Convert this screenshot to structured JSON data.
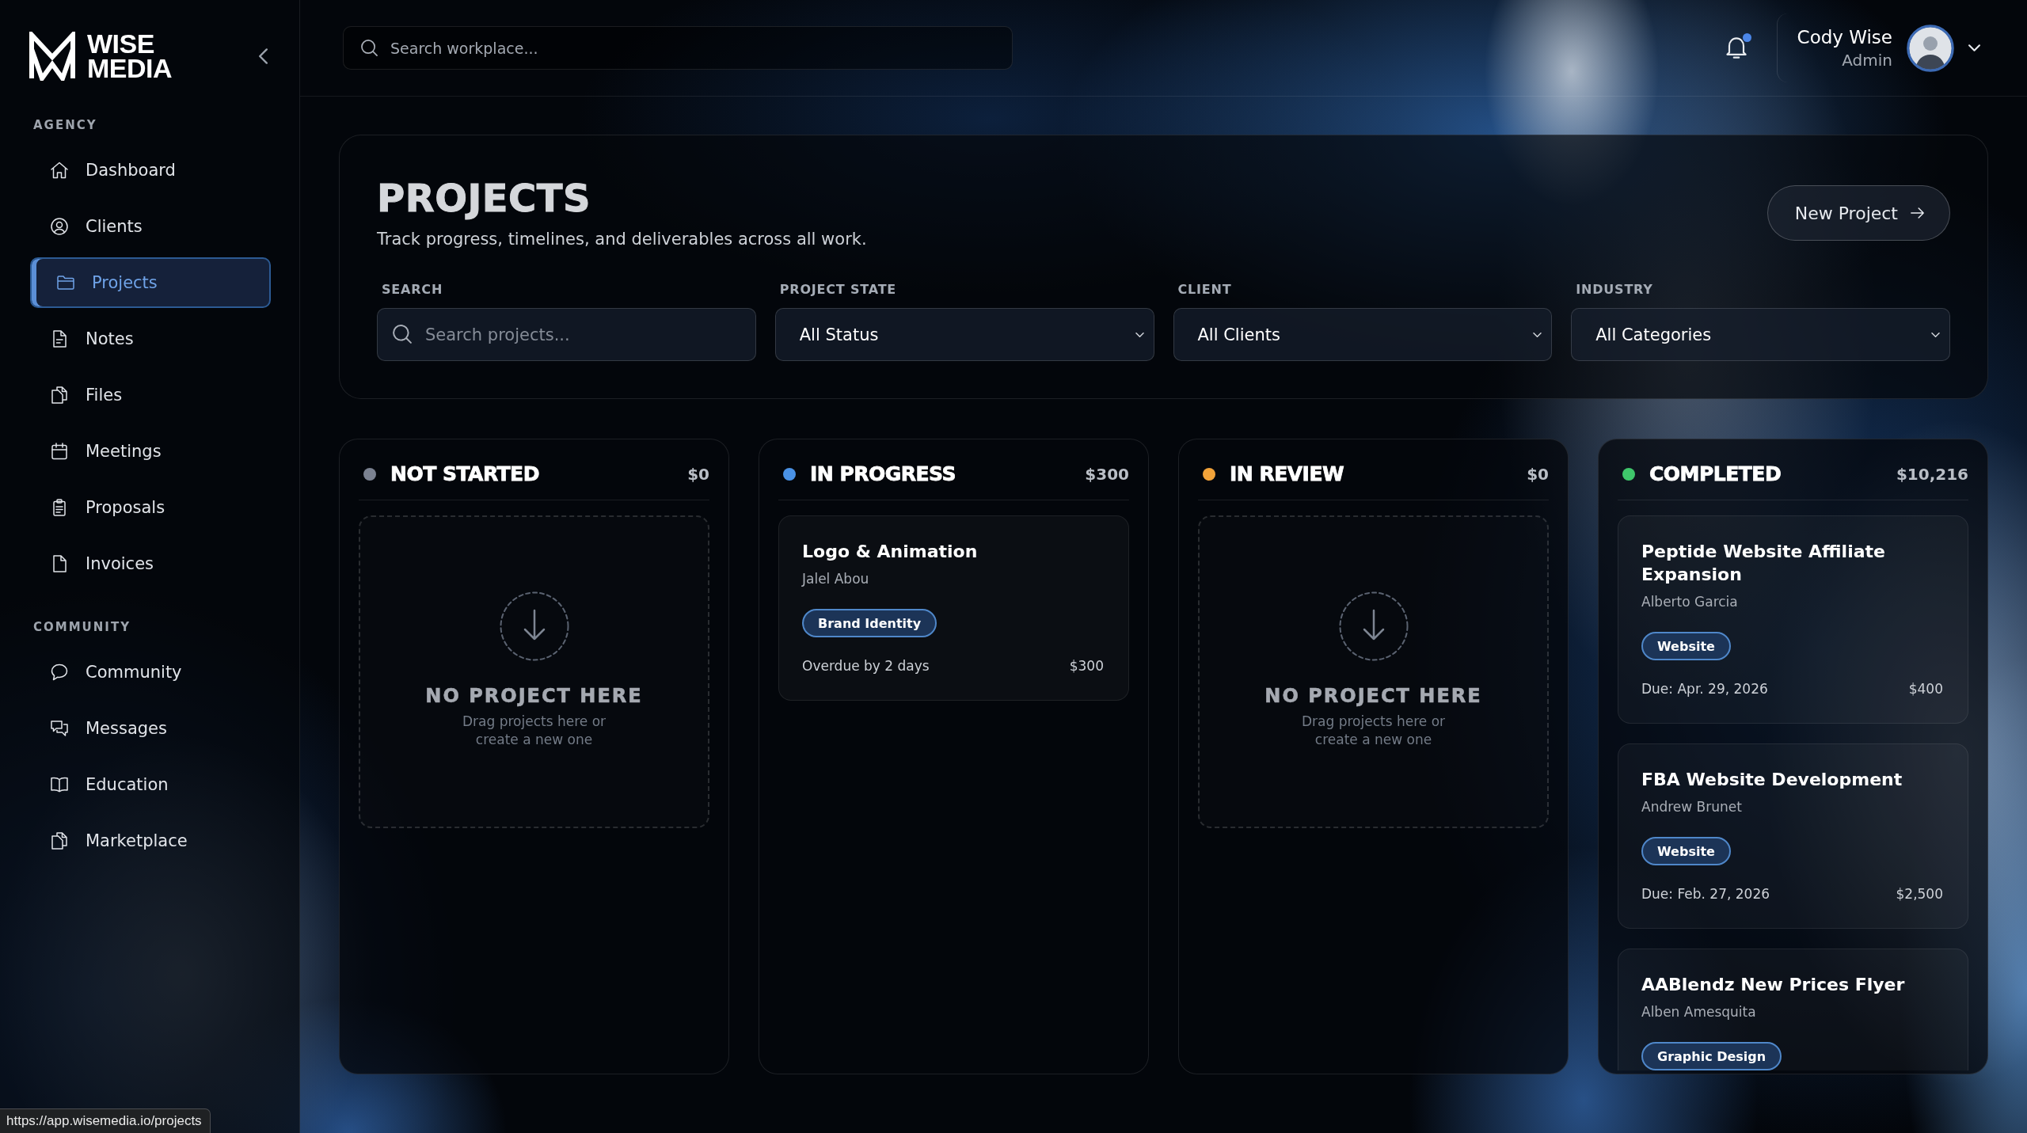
{
  "sidebar": {
    "logo": "WISE MEDIA",
    "sections": [
      {
        "title": "AGENCY",
        "items": [
          {
            "label": "Dashboard",
            "selected": false
          },
          {
            "label": "Clients",
            "selected": false
          },
          {
            "label": "Projects",
            "selected": true
          },
          {
            "label": "Notes",
            "selected": false
          },
          {
            "label": "Files",
            "selected": false
          },
          {
            "label": "Meetings",
            "selected": false
          },
          {
            "label": "Proposals",
            "selected": false
          },
          {
            "label": "Invoices",
            "selected": false
          }
        ]
      },
      {
        "title": "COMMUNITY",
        "items": [
          {
            "label": "Community",
            "selected": false
          },
          {
            "label": "Messages",
            "selected": false
          },
          {
            "label": "Education",
            "selected": false
          },
          {
            "label": "Marketplace",
            "selected": false
          }
        ]
      }
    ]
  },
  "header": {
    "search": {
      "placeholder": "Search workplace..."
    },
    "notifications": {
      "unread": true
    },
    "user": {
      "name": "Cody Wise",
      "role": "Admin"
    }
  },
  "page": {
    "title": "PROJECTS",
    "subtitle": "Track progress, timelines, and deliverables across all work.",
    "new_project_button": "New Project",
    "filters": [
      {
        "kind": "search",
        "label": "SEARCH",
        "placeholder": "Search projects..."
      },
      {
        "kind": "select",
        "label": "PROJECT STATE",
        "value": "All Status"
      },
      {
        "kind": "select",
        "label": "CLIENT",
        "value": "All Clients"
      },
      {
        "kind": "select",
        "label": "INDUSTRY",
        "value": "All Categories"
      }
    ]
  },
  "columns": [
    {
      "title": "NOT STARTED",
      "color": "#7b8291",
      "total": "$0",
      "empty": {
        "title": "NO PROJECT HERE",
        "hint": "Drag projects here or create a new one"
      }
    },
    {
      "title": "IN PROGRESS",
      "color": "#4a92e6",
      "total": "$300",
      "cards": [
        {
          "title": "Logo & Animation",
          "client": "Jalel Abou",
          "tag": "Brand Identity",
          "due": "Overdue by 2 days",
          "amount": "$300"
        }
      ]
    },
    {
      "title": "IN REVIEW",
      "color": "#f2a33a",
      "total": "$0",
      "empty": {
        "title": "NO PROJECT HERE",
        "hint": "Drag projects here or create a new one"
      }
    },
    {
      "title": "COMPLETED",
      "color": "#3fc76b",
      "total": "$10,216",
      "cards": [
        {
          "title": "Peptide Website Affiliate Expansion",
          "client": "Alberto Garcia",
          "tag": "Website",
          "due": "Due: Apr. 29, 2026",
          "amount": "$400"
        },
        {
          "title": "FBA Website Development",
          "client": "Andrew Brunet",
          "tag": "Website",
          "due": "Due: Feb. 27, 2026",
          "amount": "$2,500"
        },
        {
          "title": "AABlendz New Prices Flyer",
          "client": "Alben Amesquita",
          "tag": "Graphic Design"
        }
      ]
    }
  ],
  "status_bar": {
    "url": "https://app.wisemedia.io/projects"
  }
}
